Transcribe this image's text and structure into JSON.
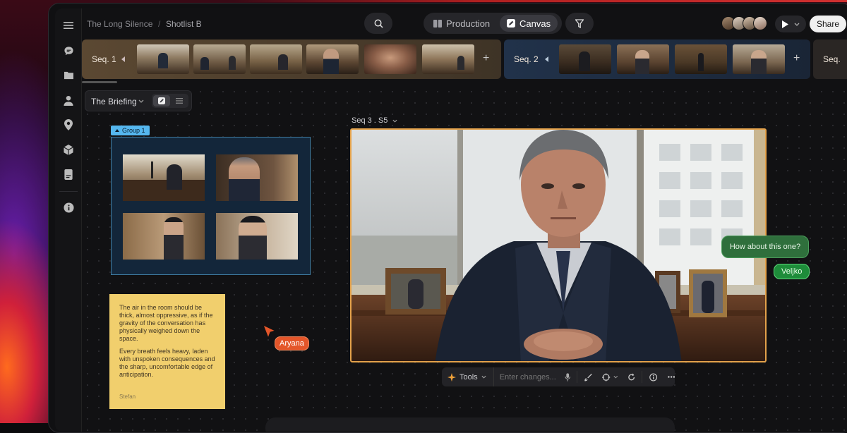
{
  "breadcrumb": {
    "project": "The Long Silence",
    "separator": "/",
    "page": "Shotlist B"
  },
  "header": {
    "search_icon": "search-icon",
    "tabs": [
      {
        "label": "Production",
        "active": false
      },
      {
        "label": "Canvas",
        "active": true
      }
    ],
    "filter_icon": "filter-icon",
    "share_label": "Share"
  },
  "strip": {
    "sequences": [
      {
        "label": "Seq. 1",
        "thumb_count": 6
      },
      {
        "label": "Seq. 2",
        "thumb_count": 4
      },
      {
        "label": "Seq."
      }
    ],
    "add_symbol": "+"
  },
  "board": {
    "scene_selector": "The Briefing",
    "group_label": "Group 1",
    "frame_label": "Seq 3 . S5"
  },
  "note": {
    "paragraph1": "The air in the room should be thick, almost oppressive, as if the gravity of the conversation has physically weighed down the space.",
    "paragraph2": "Every breath feels heavy, laden with unspoken consequences and the sharp, uncomfortable edge of anticipation.",
    "author": "Stefan"
  },
  "collaborators": {
    "cursor1": "Aryana",
    "comment": "How about this one?",
    "cursor2": "Veljko"
  },
  "toolbar": {
    "tools_label": "Tools",
    "input_placeholder": "Enter changes..."
  },
  "colors": {
    "accent_selection": "#e3a14a",
    "group_blue": "#55b7ef",
    "note_yellow": "#f1cf6d",
    "aryana_orange": "#e4562a",
    "veljko_green": "#1e8c3a"
  }
}
